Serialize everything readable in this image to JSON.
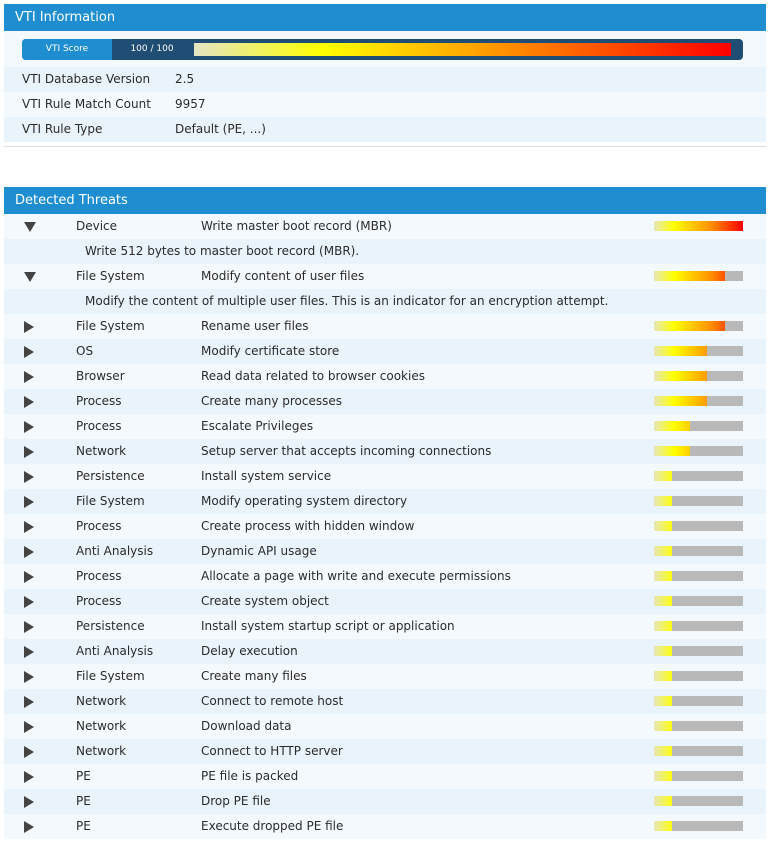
{
  "vti": {
    "header": "VTI Information",
    "score_label": "VTI Score",
    "score_text": "100 / 100",
    "score_fraction": 1.0,
    "rows": [
      {
        "key": "VTI Database Version",
        "value": "2.5"
      },
      {
        "key": "VTI Rule Match Count",
        "value": "9957"
      },
      {
        "key": "VTI Rule Type",
        "value": "Default (PE, ...)"
      }
    ]
  },
  "threats": {
    "header": "Detected Threats",
    "items": [
      {
        "category": "Device",
        "name": "Write master boot record (MBR)",
        "level": 1.0,
        "expanded": true,
        "detail": "Write 512 bytes to master boot record (MBR)."
      },
      {
        "category": "File System",
        "name": "Modify content of user files",
        "level": 0.8,
        "expanded": true,
        "detail": "Modify the content of multiple user files. This is an indicator for an encryption attempt."
      },
      {
        "category": "File System",
        "name": "Rename user files",
        "level": 0.8
      },
      {
        "category": "OS",
        "name": "Modify certificate store",
        "level": 0.6
      },
      {
        "category": "Browser",
        "name": "Read data related to browser cookies",
        "level": 0.6
      },
      {
        "category": "Process",
        "name": "Create many processes",
        "level": 0.6
      },
      {
        "category": "Process",
        "name": "Escalate Privileges",
        "level": 0.4
      },
      {
        "category": "Network",
        "name": "Setup server that accepts incoming connections",
        "level": 0.4
      },
      {
        "category": "Persistence",
        "name": "Install system service",
        "level": 0.2
      },
      {
        "category": "File System",
        "name": "Modify operating system directory",
        "level": 0.2
      },
      {
        "category": "Process",
        "name": "Create process with hidden window",
        "level": 0.2
      },
      {
        "category": "Anti Analysis",
        "name": "Dynamic API usage",
        "level": 0.2
      },
      {
        "category": "Process",
        "name": "Allocate a page with write and execute permissions",
        "level": 0.2
      },
      {
        "category": "Process",
        "name": "Create system object",
        "level": 0.2
      },
      {
        "category": "Persistence",
        "name": "Install system startup script or application",
        "level": 0.2
      },
      {
        "category": "Anti Analysis",
        "name": "Delay execution",
        "level": 0.2
      },
      {
        "category": "File System",
        "name": "Create many files",
        "level": 0.2
      },
      {
        "category": "Network",
        "name": "Connect to remote host",
        "level": 0.2
      },
      {
        "category": "Network",
        "name": "Download data",
        "level": 0.2
      },
      {
        "category": "Network",
        "name": "Connect to HTTP server",
        "level": 0.2
      },
      {
        "category": "PE",
        "name": "PE file is packed",
        "level": 0.2
      },
      {
        "category": "PE",
        "name": "Drop PE file",
        "level": 0.2
      },
      {
        "category": "PE",
        "name": "Execute dropped PE file",
        "level": 0.2
      }
    ]
  }
}
